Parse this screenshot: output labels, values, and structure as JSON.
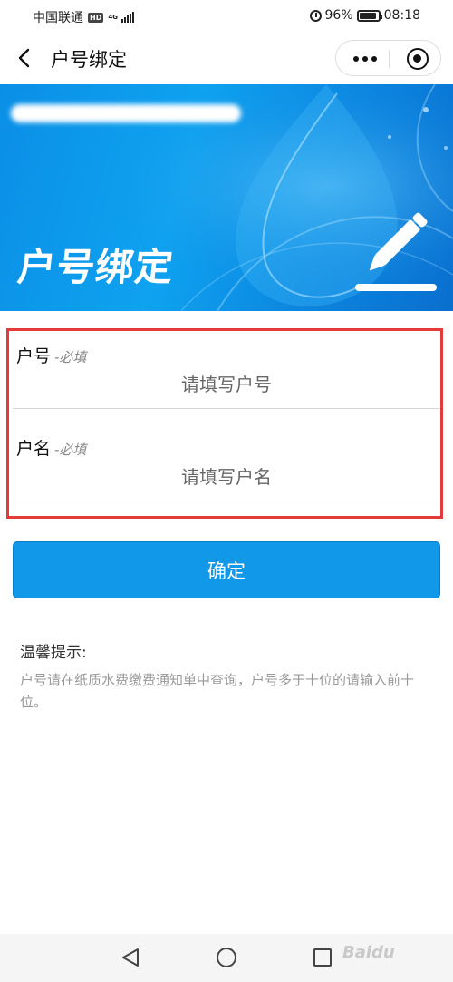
{
  "status_bar": {
    "carrier": "中国联通",
    "hd": "HD",
    "network": "4G",
    "battery": "96%",
    "time": "08:18"
  },
  "nav": {
    "title": "户号绑定"
  },
  "banner": {
    "title": "户号绑定"
  },
  "form": {
    "fields": [
      {
        "label": "户号",
        "required": "-必填",
        "placeholder": "请填写户号"
      },
      {
        "label": "户名",
        "required": "-必填",
        "placeholder": "请填写户名"
      }
    ]
  },
  "confirm_label": "确定",
  "tips": {
    "title": "温馨提示:",
    "text": "户号请在纸质水费缴费通知单中查询，户号多于十位的请输入前十位。"
  },
  "watermark": "Baidu"
}
